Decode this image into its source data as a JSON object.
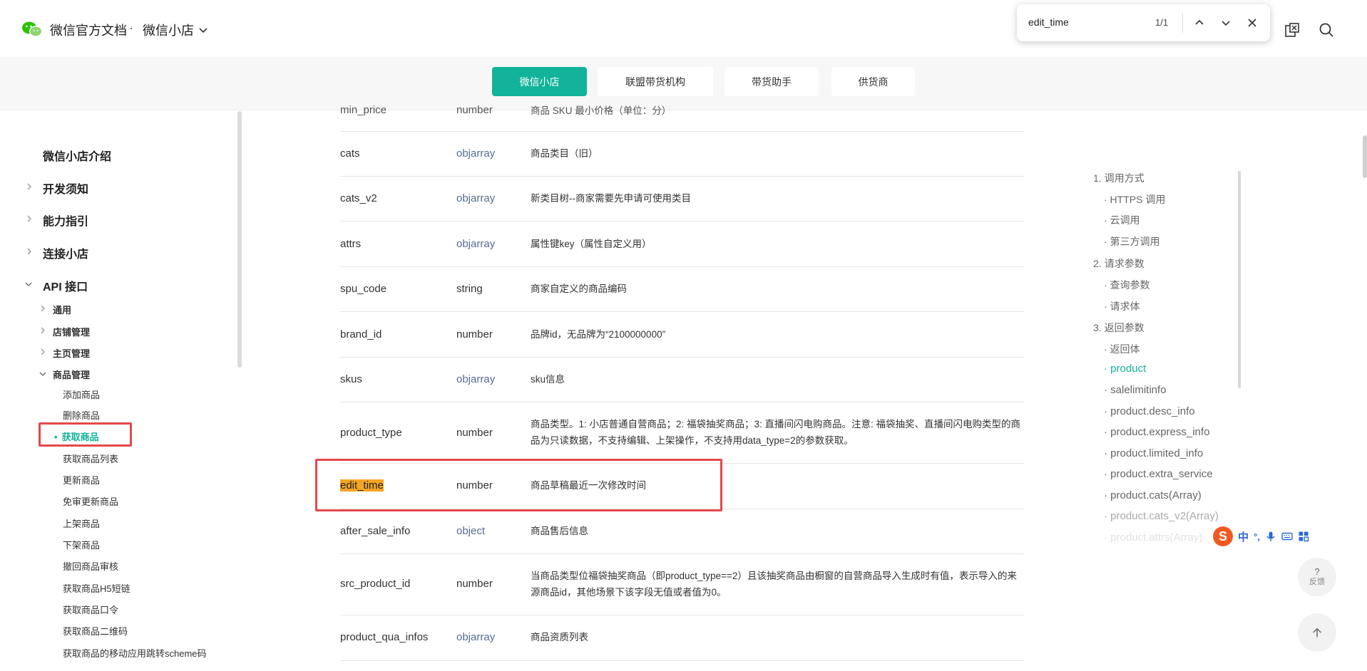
{
  "header": {
    "brand": "微信官方文档",
    "dot": "·",
    "product": "微信小店"
  },
  "find": {
    "query": "edit_time",
    "count": "1/1"
  },
  "tabs": [
    {
      "label": "微信小店"
    },
    {
      "label": "联盟带货机构"
    },
    {
      "label": "带货助手"
    },
    {
      "label": "供货商"
    }
  ],
  "sidebar": {
    "intro": "微信小店介绍",
    "dev_notice": "开发须知",
    "capability": "能力指引",
    "connect": "连接小店",
    "api": "API 接口",
    "groups": {
      "common": "通用",
      "store": "店铺管理",
      "homepage": "主页管理",
      "goods": "商品管理"
    },
    "goods_items": [
      "添加商品",
      "删除商品",
      "获取商品",
      "获取商品列表",
      "更新商品",
      "免审更新商品",
      "上架商品",
      "下架商品",
      "撤回商品审核",
      "获取商品H5短链",
      "获取商品口令",
      "获取商品二维码",
      "获取商品的移动应用跳转scheme码"
    ]
  },
  "table": {
    "rows": [
      {
        "name": "min_price",
        "type": "number",
        "desc": "商品 SKU 最小价格（单位：分）"
      },
      {
        "name": "cats",
        "type": "objarray",
        "desc": "商品类目（旧）"
      },
      {
        "name": "cats_v2",
        "type": "objarray",
        "desc": "新类目树--商家需要先申请可使用类目"
      },
      {
        "name": "attrs",
        "type": "objarray",
        "desc": "属性键key（属性自定义用）"
      },
      {
        "name": "spu_code",
        "type": "string",
        "desc": "商家自定义的商品编码"
      },
      {
        "name": "brand_id",
        "type": "number",
        "desc": "品牌id，无品牌为“2100000000”"
      },
      {
        "name": "skus",
        "type": "objarray",
        "desc": "sku信息"
      },
      {
        "name": "product_type",
        "type": "number",
        "desc": "商品类型。1: 小店普通自营商品；2: 福袋抽奖商品；3: 直播间闪电购商品。注意: 福袋抽奖、直播间闪电购类型的商品为只读数据，不支持编辑、上架操作，不支持用data_type=2的参数获取。"
      },
      {
        "name": "edit_time",
        "type": "number",
        "desc": "商品草稿最近一次修改时间"
      },
      {
        "name": "after_sale_info",
        "type": "object",
        "desc": "商品售后信息"
      },
      {
        "name": "src_product_id",
        "type": "number",
        "desc": "当商品类型位福袋抽奖商品（即product_type==2）且该抽奖商品由橱窗的自营商品导入生成时有值，表示导入的来源商品id，其他场景下该字段无值或者值为0。"
      },
      {
        "name": "product_qua_infos",
        "type": "objarray",
        "desc": "商品资质列表"
      }
    ]
  },
  "toc": [
    "1. 调用方式",
    "· HTTPS 调用",
    "· 云调用",
    "· 第三方调用",
    "2. 请求参数",
    "· 查询参数",
    "· 请求体",
    "3. 返回参数",
    "· 返回体",
    "· product",
    "· salelimitinfo",
    "· product.desc_info",
    "· product.express_info",
    "· product.limited_info",
    "· product.extra_service",
    "· product.cats(Array)",
    "· product.cats_v2(Array)",
    "· product.attrs(Array)"
  ],
  "ime": {
    "logo": "S",
    "lang": "中",
    "punct": "°,"
  },
  "feedback": {
    "icon": "?",
    "label": "反馈"
  },
  "colors": {
    "accent": "#12b39a",
    "link": "#576b95",
    "highlight": "#f5a524",
    "annotation": "#e5484d"
  }
}
